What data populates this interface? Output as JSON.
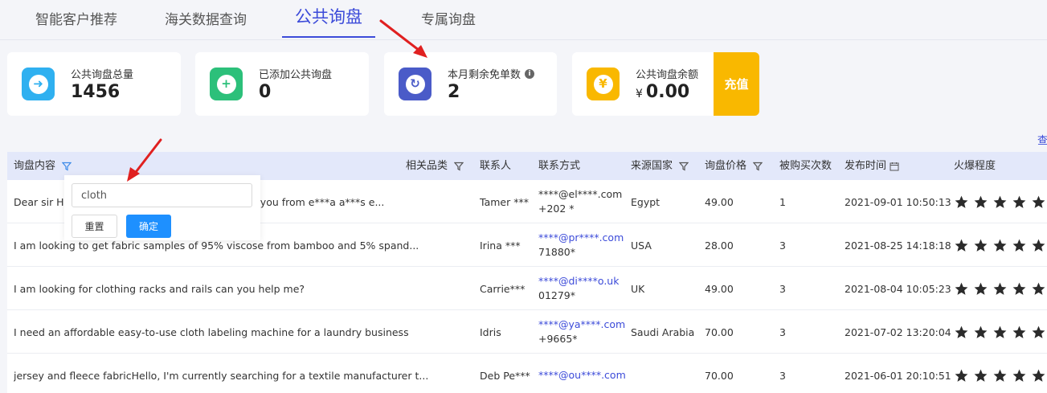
{
  "tabs": [
    {
      "label": "智能客户推荐"
    },
    {
      "label": "海关数据查询"
    },
    {
      "label": "公共询盘"
    },
    {
      "label": "专属询盘"
    }
  ],
  "stats": [
    {
      "label": "公共询盘总量",
      "value": "1456",
      "icon": "arrow-right-bubble-icon",
      "color": "#2fb0f0"
    },
    {
      "label": "已添加公共询盘",
      "value": "0",
      "icon": "plus-circle-icon",
      "color": "#2cc07a"
    },
    {
      "label": "本月剩余免单数",
      "value": "2",
      "icon": "refresh-icon",
      "color": "#4a5bc8"
    },
    {
      "label": "公共询盘余额",
      "currency": "¥",
      "value": "0.00",
      "icon": "yen-icon",
      "color": "#f9b800"
    }
  ],
  "recharge_label": "充值",
  "view_link": "查",
  "table": {
    "headers": [
      "询盘内容",
      "相关品类",
      "联系人",
      "联系方式",
      "来源国家",
      "询盘价格",
      "被购买次数",
      "发布时间",
      "火爆程度"
    ],
    "rows": [
      {
        "content": "Dear sir Ho",
        "content_tail": "th you from e***a a***s e...",
        "contact": "Tamer ***",
        "email": "****@el****.com",
        "email_link": false,
        "phone": "+202 *",
        "country": "Egypt",
        "price": "49.00",
        "bought": "1",
        "time": "2021-09-01 10:50:13",
        "stars": 5
      },
      {
        "content": "I am looking to get fabric samples of 95% viscose from bamboo and 5% spand...",
        "contact": "Irina ***",
        "email": "****@pr****.com",
        "email_link": true,
        "phone": "71880*",
        "country": "USA",
        "price": "28.00",
        "bought": "3",
        "time": "2021-08-25 14:18:18",
        "stars": 5
      },
      {
        "content": "I am looking for clothing racks and rails can you help me?",
        "contact": "Carrie***",
        "email": "****@di****o.uk",
        "email_link": true,
        "phone": "01279*",
        "country": "UK",
        "price": "49.00",
        "bought": "3",
        "time": "2021-08-04 10:05:23",
        "stars": 5
      },
      {
        "content": "I need an affordable easy-to-use cloth labeling machine for a laundry business",
        "contact": "Idris",
        "email": "****@ya****.com",
        "email_link": true,
        "phone": "+9665*",
        "country": "Saudi Arabia",
        "price": "70.00",
        "bought": "3",
        "time": "2021-07-02 13:20:04",
        "stars": 5
      },
      {
        "content": "jersey and fleece fabricHello, I'm currently searching for a textile manufacturer t...",
        "contact": "Deb Pe***",
        "email": "****@ou****.com",
        "email_link": true,
        "phone": "",
        "country": "",
        "price": "70.00",
        "bought": "3",
        "time": "2021-06-01 20:10:51",
        "stars": 5
      }
    ]
  },
  "filter_popover": {
    "input_value": "cloth",
    "reset_label": "重置",
    "confirm_label": "确定"
  },
  "annotation_color": "#e02020"
}
